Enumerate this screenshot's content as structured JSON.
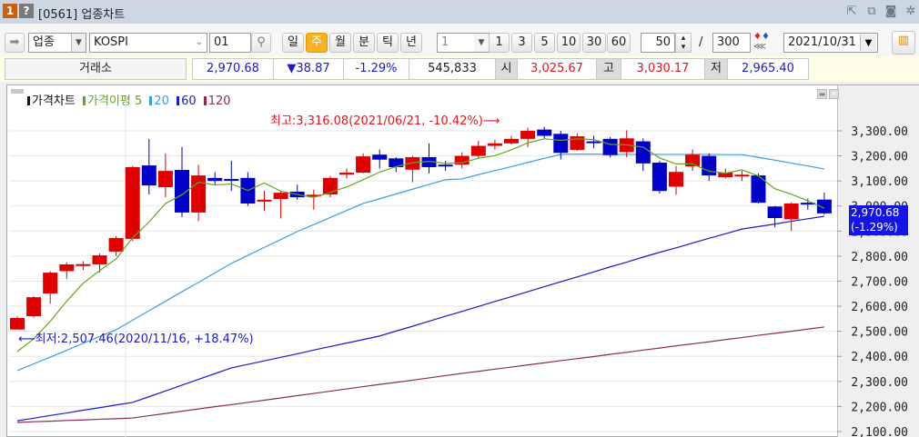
{
  "window": {
    "title": "[0561] 업종차트",
    "badge_num": "1",
    "badge_help": "?",
    "icons": [
      "popout-icon",
      "copy-window-icon",
      "camera-icon",
      "gear-icon"
    ]
  },
  "toolbar": {
    "market_type": "업종",
    "index_name": "KOSPI",
    "code": "01",
    "periods": [
      "일",
      "주",
      "월",
      "분",
      "틱",
      "년"
    ],
    "active_period": "주",
    "interval": "1",
    "intervals": [
      "1",
      "3",
      "5",
      "10",
      "30",
      "60"
    ],
    "count": "50",
    "total": "300",
    "separator": "/",
    "date": "2021/10/31"
  },
  "info": {
    "exchange": "거래소",
    "price": "2,970.68",
    "change": "▼38.87",
    "change_pct": "-1.29%",
    "volume": "545,833",
    "open_label": "시",
    "open": "3,025.67",
    "high_label": "고",
    "high": "3,030.17",
    "low_label": "저",
    "low": "2,965.40"
  },
  "chart_data": {
    "type": "candlestick",
    "legend": [
      {
        "name": "가격차트",
        "color": "#111111"
      },
      {
        "name": "가격이평 5",
        "color": "#5fa81e"
      },
      {
        "name": "20",
        "color": "#3a9ee6"
      },
      {
        "name": "60",
        "color": "#1a1acc"
      },
      {
        "name": "120",
        "color": "#8b2a5a"
      }
    ],
    "up_color": "#e00000",
    "down_color": "#0000c8",
    "ylim": [
      2100,
      3340
    ],
    "yticks": [
      3300,
      3200,
      3100,
      3000,
      2900,
      2800,
      2700,
      2600,
      2500,
      2400,
      2300,
      2200,
      2100
    ],
    "ytick_labels": [
      "3,300.00",
      "3,200.00",
      "3,100.00",
      "3,000.00",
      "2,900.00",
      "2,800.00",
      "2,700.00",
      "2,600.00",
      "2,500.00",
      "2,400.00",
      "2,300.00",
      "2,200.00",
      "2,100.00"
    ],
    "grid": true,
    "ohlc": [
      [
        2507,
        2560,
        2507,
        2553
      ],
      [
        2560,
        2640,
        2555,
        2636
      ],
      [
        2651,
        2740,
        2610,
        2734
      ],
      [
        2740,
        2775,
        2710,
        2767
      ],
      [
        2762,
        2780,
        2745,
        2768
      ],
      [
        2767,
        2810,
        2735,
        2803
      ],
      [
        2818,
        2880,
        2800,
        2872
      ],
      [
        2869,
        3160,
        2860,
        3155
      ],
      [
        3162,
        3267,
        3046,
        3082
      ],
      [
        3075,
        3210,
        3035,
        3140
      ],
      [
        3144,
        3235,
        2955,
        2974
      ],
      [
        2974,
        3165,
        2940,
        3122
      ],
      [
        3112,
        3135,
        3085,
        3100
      ],
      [
        3108,
        3180,
        3060,
        3105
      ],
      [
        3112,
        3135,
        3000,
        3010
      ],
      [
        3020,
        3060,
        2980,
        3025
      ],
      [
        3028,
        3060,
        2950,
        3053
      ],
      [
        3057,
        3085,
        3025,
        3035
      ],
      [
        3040,
        3065,
        2985,
        3045
      ],
      [
        3046,
        3120,
        3035,
        3112
      ],
      [
        3125,
        3150,
        3110,
        3133
      ],
      [
        3133,
        3210,
        3130,
        3198
      ],
      [
        3205,
        3225,
        3150,
        3185
      ],
      [
        3190,
        3195,
        3135,
        3155
      ],
      [
        3145,
        3200,
        3095,
        3195
      ],
      [
        3195,
        3250,
        3130,
        3155
      ],
      [
        3165,
        3180,
        3140,
        3160
      ],
      [
        3165,
        3215,
        3150,
        3200
      ],
      [
        3200,
        3260,
        3190,
        3240
      ],
      [
        3240,
        3265,
        3225,
        3250
      ],
      [
        3250,
        3280,
        3245,
        3268
      ],
      [
        3268,
        3312,
        3235,
        3300
      ],
      [
        3305,
        3316,
        3270,
        3280
      ],
      [
        3288,
        3300,
        3186,
        3212
      ],
      [
        3224,
        3290,
        3220,
        3278
      ],
      [
        3258,
        3280,
        3230,
        3255
      ],
      [
        3268,
        3275,
        3195,
        3203
      ],
      [
        3215,
        3302,
        3195,
        3270
      ],
      [
        3258,
        3270,
        3140,
        3170
      ],
      [
        3173,
        3180,
        3050,
        3060
      ],
      [
        3077,
        3160,
        3045,
        3136
      ],
      [
        3158,
        3225,
        3140,
        3205
      ],
      [
        3200,
        3210,
        3100,
        3122
      ],
      [
        3115,
        3150,
        3110,
        3133
      ],
      [
        3120,
        3140,
        3100,
        3125
      ],
      [
        3122,
        3130,
        3010,
        3013
      ],
      [
        2998,
        3000,
        2915,
        2952
      ],
      [
        2947,
        3015,
        2900,
        3010
      ],
      [
        3013,
        3030,
        2985,
        3007
      ],
      [
        3025.67,
        3053,
        2965.4,
        2970.68
      ]
    ],
    "ma5": [
      2419,
      2470,
      2540,
      2620,
      2692,
      2742,
      2789,
      2873,
      2936,
      3010,
      3045,
      3095,
      3084,
      3088,
      3062,
      3092,
      3059,
      3046,
      3034,
      3054,
      3076,
      3105,
      3135,
      3157,
      3173,
      3178,
      3170,
      3173,
      3190,
      3201,
      3224,
      3252,
      3268,
      3262,
      3268,
      3265,
      3246,
      3244,
      3235,
      3192,
      3168,
      3168,
      3139,
      3131,
      3144,
      3120,
      3069,
      3047,
      3021,
      2991
    ],
    "ma20": [
      2343,
      2370,
      2397,
      2424,
      2452,
      2479,
      2506,
      2544,
      2582,
      2620,
      2658,
      2695,
      2733,
      2771,
      2803,
      2835,
      2866,
      2898,
      2926,
      2954,
      2982,
      3010,
      3029,
      3048,
      3067,
      3086,
      3105,
      3108,
      3125,
      3141,
      3157,
      3174,
      3190,
      3206,
      3207,
      3207,
      3206,
      3206,
      3206,
      3206,
      3206,
      3206,
      3206,
      3205,
      3205,
      3194,
      3183,
      3171,
      3160,
      3148
    ],
    "ma60": [
      2143,
      2153,
      2164,
      2174,
      2185,
      2195,
      2206,
      2216,
      2239,
      2262,
      2285,
      2308,
      2331,
      2354,
      2368,
      2382,
      2396,
      2410,
      2425,
      2439,
      2453,
      2467,
      2481,
      2501,
      2520,
      2540,
      2560,
      2579,
      2599,
      2619,
      2638,
      2658,
      2678,
      2698,
      2717,
      2737,
      2757,
      2776,
      2796,
      2815,
      2833,
      2852,
      2871,
      2889,
      2908,
      2918,
      2928,
      2939,
      2949,
      2959
    ],
    "ma120": [
      2136,
      2139,
      2141,
      2144,
      2146,
      2149,
      2151,
      2154,
      2163,
      2172,
      2181,
      2190,
      2199,
      2207,
      2216,
      2225,
      2234,
      2243,
      2252,
      2261,
      2270,
      2279,
      2288,
      2296,
      2305,
      2314,
      2323,
      2332,
      2340,
      2349,
      2357,
      2366,
      2374,
      2383,
      2391,
      2399,
      2408,
      2416,
      2425,
      2433,
      2442,
      2450,
      2458,
      2467,
      2475,
      2484,
      2492,
      2500,
      2509,
      2517
    ],
    "max_annotation": "최고:3,316.08(2021/06/21, -10.42%)⟶",
    "min_annotation": "⟵최저:2,507.46(2020/11/16, +18.47%)",
    "current_price": "2,970.68",
    "current_pct": "(-1.29%)"
  }
}
